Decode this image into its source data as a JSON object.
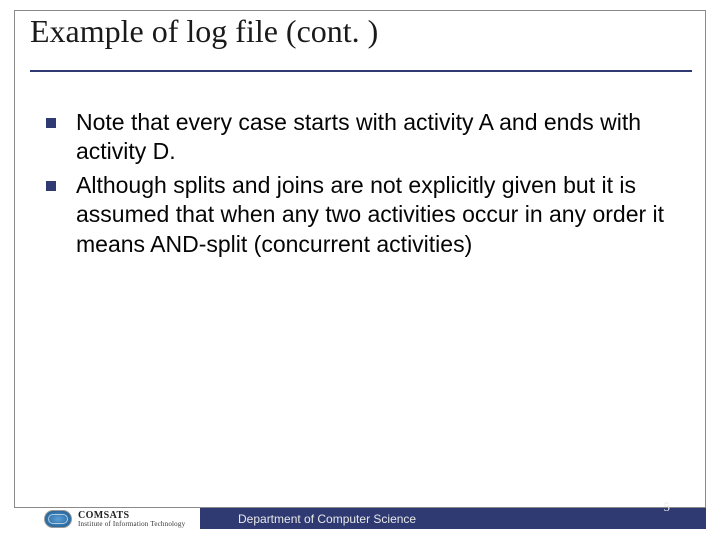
{
  "title": "Example of log file (cont. )",
  "bullets": [
    "Note that every case starts with activity A and ends with activity D.",
    "Although splits and joins are not explicitly given but it is assumed that when any two activities occur in any order it means AND-split (concurrent activities)"
  ],
  "footer": "Department of Computer Science",
  "page_number": "5",
  "logo": {
    "line1": "COMSATS",
    "line2": "Institute of Information Technology"
  }
}
